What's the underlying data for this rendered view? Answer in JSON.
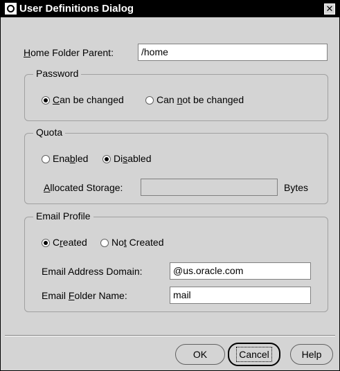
{
  "dialog": {
    "title": "User Definitions Dialog",
    "close_glyph": "✕"
  },
  "home_folder": {
    "label": "Home Folder Parent:",
    "value": "/home"
  },
  "password": {
    "legend": "Password",
    "options": [
      {
        "label": "Can be changed",
        "checked": true
      },
      {
        "label": "Can not be changed",
        "checked": false
      }
    ]
  },
  "quota": {
    "legend": "Quota",
    "options": [
      {
        "label": "Enabled",
        "checked": false
      },
      {
        "label": "Disabled",
        "checked": true
      }
    ],
    "storage_label": "Allocated Storage:",
    "storage_value": "",
    "storage_unit": "Bytes"
  },
  "email": {
    "legend": "Email Profile",
    "options": [
      {
        "label": "Created",
        "checked": true
      },
      {
        "label": "Not Created",
        "checked": false
      }
    ],
    "domain_label": "Email Address Domain:",
    "domain_value": "@us.oracle.com",
    "folder_label": "Email Folder Name:",
    "folder_value": "mail"
  },
  "buttons": {
    "ok": "OK",
    "cancel": "Cancel",
    "help": "Help"
  },
  "icons": {
    "app": "oracle-logo-icon",
    "close": "close-icon"
  }
}
